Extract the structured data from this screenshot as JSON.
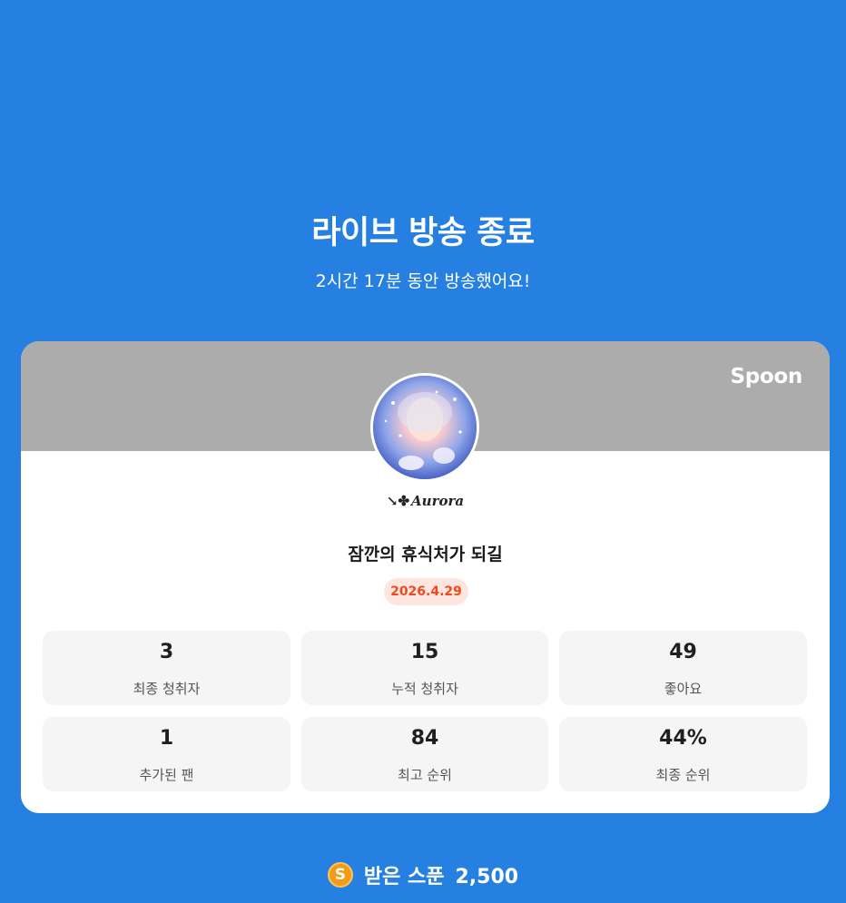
{
  "header": {
    "title": "라이브 방송 종료",
    "subtitle": "2시간 17분 동안 방송했어요!"
  },
  "card": {
    "brand": "Spoon",
    "nickname_deco": "↘✤",
    "nickname": "Aurora",
    "stream_title": "잠깐의 휴식처가 되길",
    "date": "2026.4.29",
    "stats": [
      {
        "value": "3",
        "label": "최종 청취자"
      },
      {
        "value": "15",
        "label": "누적 청취자"
      },
      {
        "value": "49",
        "label": "좋아요"
      },
      {
        "value": "1",
        "label": "추가된 팬"
      },
      {
        "value": "84",
        "label": "최고 순위"
      },
      {
        "value": "44%",
        "label": "최종 순위"
      }
    ]
  },
  "footer": {
    "coin_icon": "spoon-coin-icon",
    "coin_glyph": "S",
    "label": "받은 스푼",
    "amount": "2,500"
  },
  "colors": {
    "background": "#2580e2",
    "card_header": "#acacac",
    "badge_bg": "#fde6df",
    "badge_text": "#f04a1c",
    "stat_bg": "#f5f5f5",
    "coin": "#f39b16"
  }
}
